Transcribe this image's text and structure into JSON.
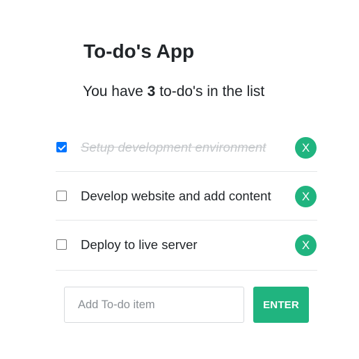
{
  "app": {
    "title": "To-do's App"
  },
  "summary": {
    "prefix": "You have",
    "count": "3",
    "suffix": "to-do's in the list"
  },
  "todos": [
    {
      "text": "Setup development environment",
      "checked": true,
      "delete_label": "X"
    },
    {
      "text": "Develop website and add content",
      "checked": false,
      "delete_label": "X"
    },
    {
      "text": "Deploy to live server",
      "checked": false,
      "delete_label": "X"
    }
  ],
  "add_form": {
    "placeholder": "Add To-do item",
    "value": "",
    "submit_label": "ENTER"
  },
  "colors": {
    "accent": "#20b47f",
    "checkbox_checked": "#0075ff",
    "completed_text": "#c4c7ca"
  }
}
